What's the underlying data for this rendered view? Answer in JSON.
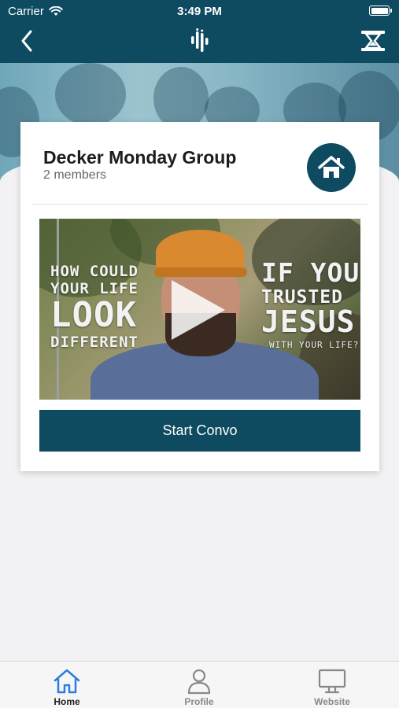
{
  "status_bar": {
    "carrier": "Carrier",
    "time": "3:49 PM"
  },
  "nav": {
    "back_icon": "chevron-left-icon",
    "logo_icon": "app-logo-icon",
    "menu_icon": "hourglass-menu-icon"
  },
  "group": {
    "title": "Decker Monday Group",
    "members": "2 members",
    "home_icon": "home-icon"
  },
  "video": {
    "left_line1": "HOW COULD",
    "left_line2": "YOUR LIFE",
    "left_line3": "LOOK",
    "left_line4": "DIFFERENT",
    "right_line1": "IF YOU",
    "right_line2": "TRUSTED",
    "right_line3": "JESUS",
    "right_line4": "WITH YOUR LIFE?",
    "play_icon": "play-icon"
  },
  "actions": {
    "start_label": "Start Convo"
  },
  "tabs": [
    {
      "label": "Home",
      "icon": "home-outline-icon",
      "active": true
    },
    {
      "label": "Profile",
      "icon": "person-icon",
      "active": false
    },
    {
      "label": "Website",
      "icon": "monitor-icon",
      "active": false
    }
  ],
  "colors": {
    "brand": "#0e4a60",
    "active_tab": "#2a7de1"
  }
}
